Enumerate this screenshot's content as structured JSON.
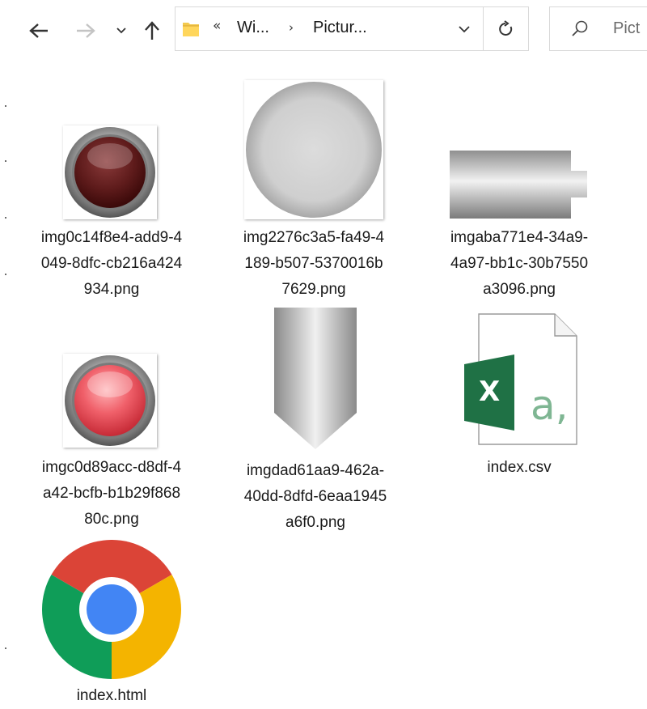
{
  "toolbar": {
    "address": {
      "overflow_chevron": "«",
      "crumb_1": "Wi...",
      "separator": "›",
      "crumb_2": "Pictur..."
    },
    "search_placeholder": "Pict"
  },
  "files": [
    {
      "name": "img0c14f8e4-add9-4049-8dfc-cb216a424934.png",
      "icon": "dark-red-round-button-image"
    },
    {
      "name": "img2276c3a5-fa49-4189-b507-5370016b7629.png",
      "icon": "gray-sphere-image"
    },
    {
      "name": "imgaba771e4-34a9-4a97-bb1c-30b7550a3096.png",
      "icon": "gray-cylinder-connector-image"
    },
    {
      "name": "imgc0d89acc-d8df-4a42-bcfb-b1b29f86880c.png",
      "icon": "bright-red-round-button-image"
    },
    {
      "name": "imgdad61aa9-462a-40dd-8dfd-6eaa1945a6f0.png",
      "icon": "gray-pointed-cylinder-image"
    },
    {
      "name": "index.csv",
      "icon": "excel-csv-file-icon",
      "glyph_x": "X",
      "glyph_a": "a,"
    },
    {
      "name": "index.html",
      "icon": "chrome-html-file-icon"
    }
  ],
  "colors": {
    "excel_green": "#1f7145",
    "excel_green_light": "#7fb693",
    "chrome_red": "#db4437",
    "chrome_green": "#0f9d58",
    "chrome_yellow": "#f4b400",
    "chrome_blue": "#4285f4"
  }
}
